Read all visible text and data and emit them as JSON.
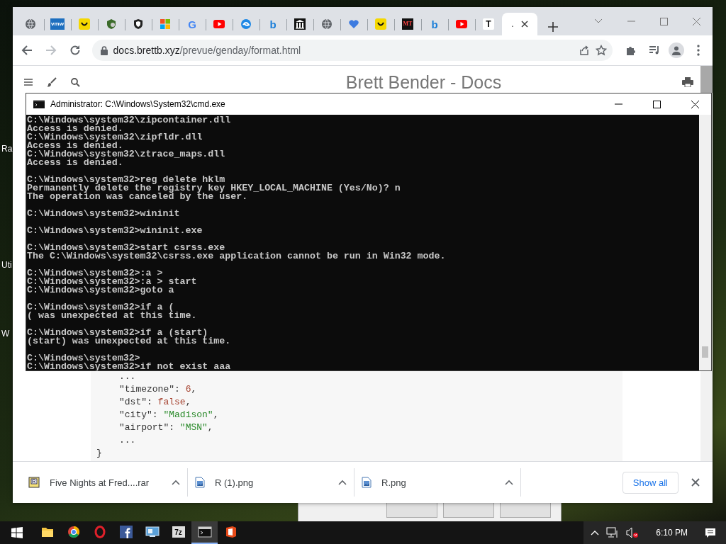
{
  "desktop": {
    "icon_labels": [
      "Ra",
      "Uti",
      "W"
    ]
  },
  "browser": {
    "tabs": [
      {
        "kind": "globe",
        "selected": false
      },
      {
        "kind": "vmw",
        "icon_text": "vmw",
        "selected": false
      },
      {
        "kind": "smile",
        "selected": false
      },
      {
        "kind": "shield-green",
        "selected": false
      },
      {
        "kind": "shield",
        "selected": false
      },
      {
        "kind": "windows",
        "selected": false
      },
      {
        "kind": "google",
        "icon_text": "G",
        "selected": false
      },
      {
        "kind": "youtube",
        "selected": false
      },
      {
        "kind": "swirl",
        "selected": false
      },
      {
        "kind": "bing",
        "icon_text": "b",
        "selected": false
      },
      {
        "kind": "museum",
        "selected": false
      },
      {
        "kind": "globe",
        "selected": false
      },
      {
        "kind": "heart",
        "selected": false
      },
      {
        "kind": "smile",
        "selected": false
      },
      {
        "kind": "mt",
        "icon_text": "MT",
        "selected": false
      },
      {
        "kind": "bing",
        "icon_text": "b",
        "selected": false
      },
      {
        "kind": "youtube",
        "selected": false
      },
      {
        "kind": "t",
        "icon_text": "T",
        "selected": false
      },
      {
        "kind": "blank",
        "title": ".",
        "selected": true
      }
    ],
    "url_host": "docs.brettb.xyz",
    "url_path": "/prevue/genday/format.html",
    "page": {
      "title": "Brett Bender - Docs",
      "code": {
        "children": [
          {
            "tokens": [
              {
                "kind": "punct",
                "text": "..."
              }
            ]
          },
          {
            "tokens": [
              {
                "kind": "key",
                "text": "\"timezone\": "
              },
              {
                "kind": "number",
                "text": "6"
              },
              {
                "kind": "punct",
                "text": ","
              }
            ]
          },
          {
            "tokens": [
              {
                "kind": "key",
                "text": "\"dst\": "
              },
              {
                "kind": "number",
                "text": "false"
              },
              {
                "kind": "punct",
                "text": ","
              }
            ]
          },
          {
            "tokens": [
              {
                "kind": "key",
                "text": "\"city\": "
              },
              {
                "kind": "string",
                "text": "\"Madison\""
              },
              {
                "kind": "punct",
                "text": ","
              }
            ]
          },
          {
            "tokens": [
              {
                "kind": "key",
                "text": "\"airport\": "
              },
              {
                "kind": "string",
                "text": "\"MSN\""
              },
              {
                "kind": "punct",
                "text": ","
              }
            ]
          },
          {
            "tokens": [
              {
                "kind": "punct",
                "text": "..."
              }
            ]
          }
        ],
        "closing": [
          {
            "kind": "punct",
            "text": "}"
          }
        ]
      }
    },
    "downloads": [
      {
        "kind": "archive",
        "name": "Five Nights at Fred....rar"
      },
      {
        "kind": "image",
        "name": "R (1).png"
      },
      {
        "kind": "image",
        "name": "R.png"
      }
    ],
    "show_all": "Show all"
  },
  "console": {
    "title": "Administrator: C:\\Windows\\System32\\cmd.exe",
    "blocks": [
      [
        "C:\\Windows\\system32\\zipcontainer.dll",
        "Access is denied.",
        "C:\\Windows\\system32\\zipfldr.dll",
        "Access is denied.",
        "C:\\Windows\\system32\\ztrace_maps.dll",
        "Access is denied."
      ],
      [
        "C:\\Windows\\system32>reg delete hklm",
        "Permanently delete the registry key HKEY_LOCAL_MACHINE (Yes/No)? n",
        "The operation was canceled by the user."
      ],
      [
        "C:\\Windows\\system32>wininit"
      ],
      [
        "C:\\Windows\\system32>wininit.exe"
      ],
      [
        "C:\\Windows\\system32>start csrss.exe",
        "The C:\\Windows\\system32\\csrss.exe application cannot be run in Win32 mode."
      ],
      [
        "C:\\Windows\\system32>:a >",
        "C:\\Windows\\system32>:a > start",
        "C:\\Windows\\system32>goto a"
      ],
      [
        "C:\\Windows\\system32>if a (",
        "( was unexpected at this time."
      ],
      [
        "C:\\Windows\\system32>if a (start)",
        "(start) was unexpected at this time."
      ],
      [
        "C:\\Windows\\system32>",
        "C:\\Windows\\system32>if not exist aaa"
      ]
    ]
  },
  "taskbar": {
    "apps": [
      {
        "kind": "explorer",
        "selected": false
      },
      {
        "kind": "chrome",
        "selected": false
      },
      {
        "kind": "opera",
        "selected": false
      },
      {
        "kind": "facebook",
        "selected": false
      },
      {
        "kind": "control-panel",
        "selected": false
      },
      {
        "kind": "archiver",
        "icon_text": "7z",
        "selected": false
      },
      {
        "kind": "cmd",
        "selected": true
      },
      {
        "kind": "office",
        "selected": false
      }
    ],
    "clock": "6:10 PM"
  }
}
